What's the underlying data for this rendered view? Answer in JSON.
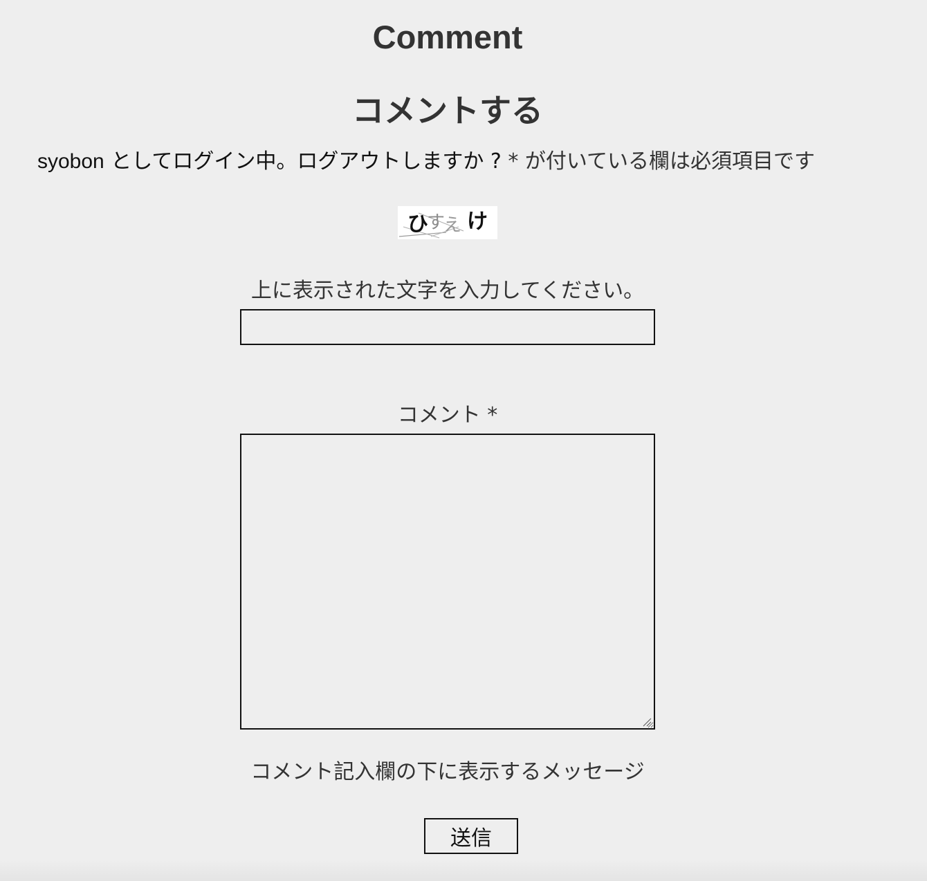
{
  "comments_section": {
    "heading": "Comment"
  },
  "respond": {
    "title": "コメントする",
    "logged_in": {
      "user": "syobon",
      "as_text": " としてログイン中。",
      "logout_link": "ログアウトしますか ?",
      "required_note": " * が付いている欄は必須項目です"
    },
    "captcha": {
      "image_text": "ひすえけ",
      "label": "上に表示された文字を入力してください。",
      "value": ""
    },
    "comment_field": {
      "label": "コメント *",
      "value": ""
    },
    "after_note": "コメント記入欄の下に表示するメッセージ",
    "submit_label": "送信"
  }
}
